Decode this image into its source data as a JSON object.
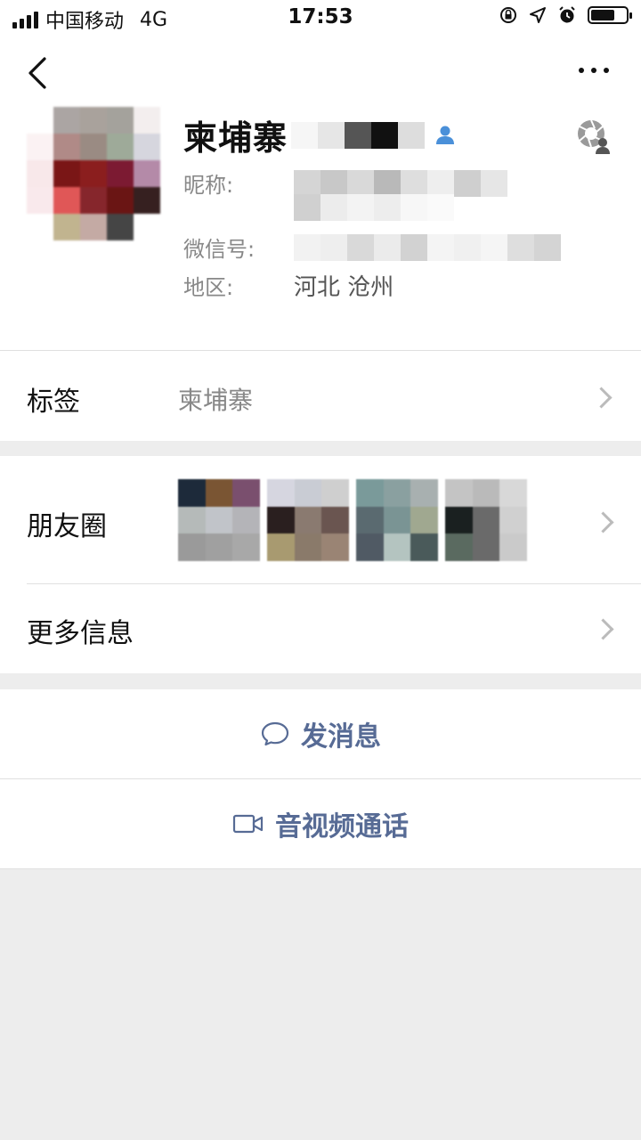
{
  "status_bar": {
    "carrier": "中国移动",
    "network": "4G",
    "time": "17:53",
    "icons": [
      "orientation-lock-icon",
      "location-arrow-icon",
      "alarm-icon",
      "battery-icon"
    ]
  },
  "nav": {
    "back_icon": "chevron-left-icon",
    "more_icon": "more-dots-icon"
  },
  "profile": {
    "name": "柬埔寨",
    "name_badge_icon": "contact-person-icon",
    "moments_icon": "moments-camera-icon",
    "nickname_label": "昵称:",
    "wechat_id_label": "微信号:",
    "region_label": "地区:",
    "region_value": "河北 沧州"
  },
  "tags_row": {
    "label": "标签",
    "value": "柬埔寨"
  },
  "moments_row": {
    "label": "朋友圈"
  },
  "more_info_row": {
    "label": "更多信息"
  },
  "actions": {
    "message_label": "发消息",
    "message_icon": "chat-bubble-icon",
    "call_label": "音视频通话",
    "call_icon": "video-camera-icon"
  },
  "colors": {
    "link_blue": "#576b95",
    "badge_blue": "#4a90d9",
    "background": "#ededed"
  }
}
